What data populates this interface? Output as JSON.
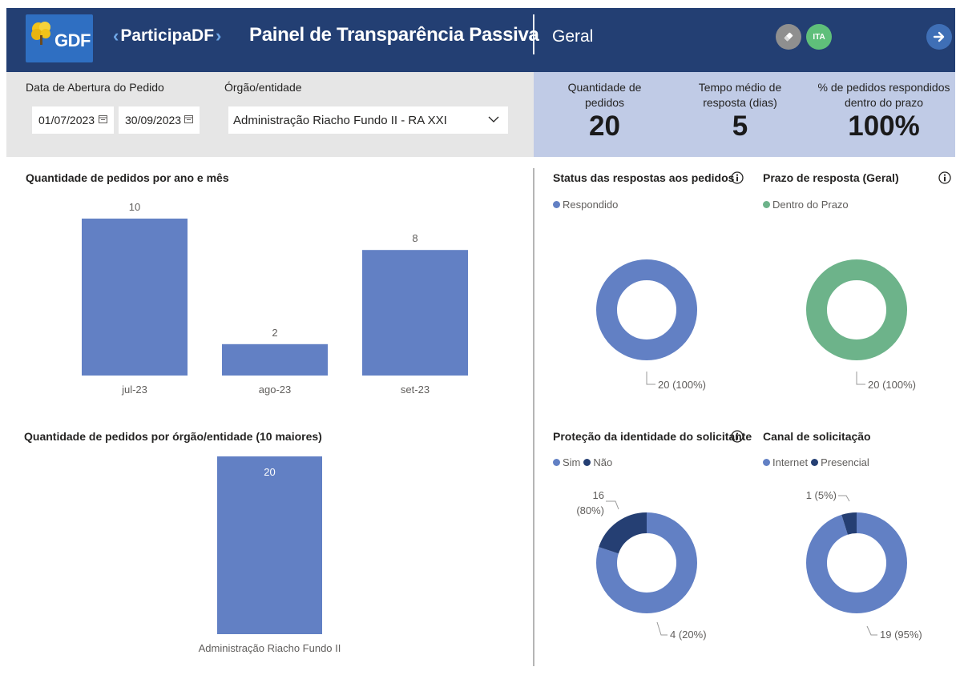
{
  "header": {
    "logo_text": "GDF",
    "brand": "ParticipaDF",
    "title": "Painel de Transparência Passiva",
    "section": "Geral",
    "user_initials": "ITA"
  },
  "filters": {
    "date_label": "Data de Abertura do Pedido",
    "date_start": "01/07/2023",
    "date_end": "30/09/2023",
    "org_label": "Órgão/entidade",
    "org_selected": "Administração Riacho Fundo II - RA XXI"
  },
  "kpis": [
    {
      "label_line1": "Quantidade de",
      "label_line2": "pedidos",
      "value": "20"
    },
    {
      "label_line1": "Tempo médio de",
      "label_line2": "resposta (dias)",
      "value": "5"
    },
    {
      "label_line1": "% de pedidos respondidos",
      "label_line2": "dentro do prazo",
      "value": "100%"
    }
  ],
  "chart_data": [
    {
      "type": "bar",
      "title": "Quantidade de pedidos por ano e mês",
      "categories": [
        "jul-23",
        "ago-23",
        "set-23"
      ],
      "values": [
        10,
        2,
        8
      ],
      "ylim": [
        0,
        10
      ],
      "color": "#6280c4",
      "grid": false
    },
    {
      "type": "bar",
      "title": "Quantidade de pedidos por órgão/entidade (10 maiores)",
      "categories": [
        "Administração Riacho Fundo II"
      ],
      "values": [
        20
      ],
      "ylim": [
        0,
        20
      ],
      "color": "#6280c4",
      "grid": false
    },
    {
      "type": "pie",
      "title": "Status das respostas aos pedidos",
      "legend_position": "top-left",
      "series": [
        {
          "name": "Respondido",
          "value": 20,
          "label": "20 (100%)",
          "color": "#6280c4"
        }
      ]
    },
    {
      "type": "pie",
      "title": "Prazo de resposta (Geral)",
      "legend_position": "top-left",
      "series": [
        {
          "name": "Dentro do Prazo",
          "value": 20,
          "label": "20 (100%)",
          "color": "#6db38a"
        }
      ]
    },
    {
      "type": "pie",
      "title": "Proteção da identidade do solicitante",
      "legend_position": "top-left",
      "series": [
        {
          "name": "Sim",
          "value": 16,
          "label_line1": "16",
          "label_line2": "(80%)",
          "color": "#6280c4"
        },
        {
          "name": "Não",
          "value": 4,
          "label": "4 (20%)",
          "color": "#253f73"
        }
      ]
    },
    {
      "type": "pie",
      "title": "Canal de solicitação",
      "legend_position": "top-left",
      "series": [
        {
          "name": "Internet",
          "value": 19,
          "label": "19 (95%)",
          "color": "#6280c4"
        },
        {
          "name": "Presencial",
          "value": 1,
          "label": "1 (5%)",
          "color": "#253f73"
        }
      ]
    }
  ]
}
